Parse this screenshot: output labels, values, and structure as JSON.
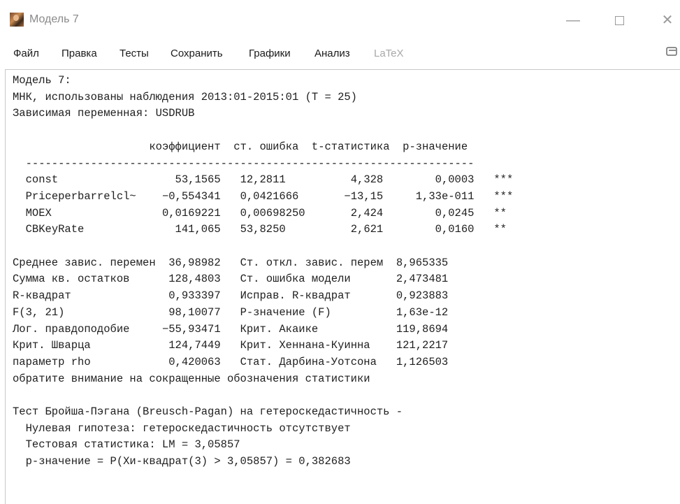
{
  "window": {
    "title": "Модель 7",
    "min_glyph": "—",
    "close_glyph": "✕"
  },
  "menu": [
    {
      "label": "Файл",
      "enabled": true
    },
    {
      "label": "Правка",
      "enabled": true
    },
    {
      "label": "Тесты",
      "enabled": true
    },
    {
      "label": "Сохранить",
      "enabled": true
    },
    {
      "label": "Графики",
      "enabled": true
    },
    {
      "label": "Анализ",
      "enabled": true
    },
    {
      "label": "LaTeX",
      "enabled": false
    }
  ],
  "toolbar_icon": "copy-icon",
  "output": {
    "header_lines": [
      "Модель 7:",
      "МНК, использованы наблюдения 2013:01-2015:01 (T = 25)",
      "Зависимая переменная: USDRUB"
    ],
    "coef_table": {
      "headers": [
        "коэффициент",
        "ст. ошибка",
        "t-статистика",
        "p-значение"
      ],
      "rows": [
        {
          "name": "const",
          "coef": "53,1565",
          "se": "12,2811",
          "t": "4,328",
          "p": "0,0003",
          "stars": "***"
        },
        {
          "name": "Priceperbarrelcl~",
          "coef": "−0,554341",
          "se": "0,0421666",
          "t": "−13,15",
          "p": "1,33e-011",
          "stars": "***"
        },
        {
          "name": "MOEX",
          "coef": "0,0169221",
          "se": "0,00698250",
          "t": "2,424",
          "p": "0,0245",
          "stars": "**"
        },
        {
          "name": "CBKeyRate",
          "coef": "141,065",
          "se": "53,8250",
          "t": "2,621",
          "p": "0,0160",
          "stars": "**"
        }
      ]
    },
    "stats": [
      {
        "l1": "Среднее завис. перемен",
        "v1": "36,98982",
        "l2": "Ст. откл. завис. перем",
        "v2": "8,965335"
      },
      {
        "l1": "Сумма кв. остатков",
        "v1": "128,4803",
        "l2": "Ст. ошибка модели",
        "v2": "2,473481"
      },
      {
        "l1": "R-квадрат",
        "v1": "0,933397",
        "l2": "Исправ. R-квадрат",
        "v2": "0,923883"
      },
      {
        "l1": "F(3, 21)",
        "v1": "98,10077",
        "l2": "Р-значение (F)",
        "v2": "1,63e-12"
      },
      {
        "l1": "Лог. правдоподобие",
        "v1": "−55,93471",
        "l2": "Крит. Акаике",
        "v2": "119,8694"
      },
      {
        "l1": "Крит. Шварца",
        "v1": "124,7449",
        "l2": "Крит. Хеннана-Куинна",
        "v2": "121,2217"
      },
      {
        "l1": "параметр rho",
        "v1": "0,420063",
        "l2": "Стат. Дарбина-Уотсона",
        "v2": "1,126503"
      }
    ],
    "stats_note": "обратите внимание на сокращенные обозначения статистики",
    "test_lines": [
      "Тест Бройша-Пэгана (Breusch-Pagan) на гетероскедастичность -",
      "  Нулевая гипотеза: гетероскедастичность отсутствует",
      "  Тестовая статистика: LM = 3,05857",
      "  p-значение = P(Хи-квадрат(3) > 3,05857) = 0,382683"
    ]
  }
}
